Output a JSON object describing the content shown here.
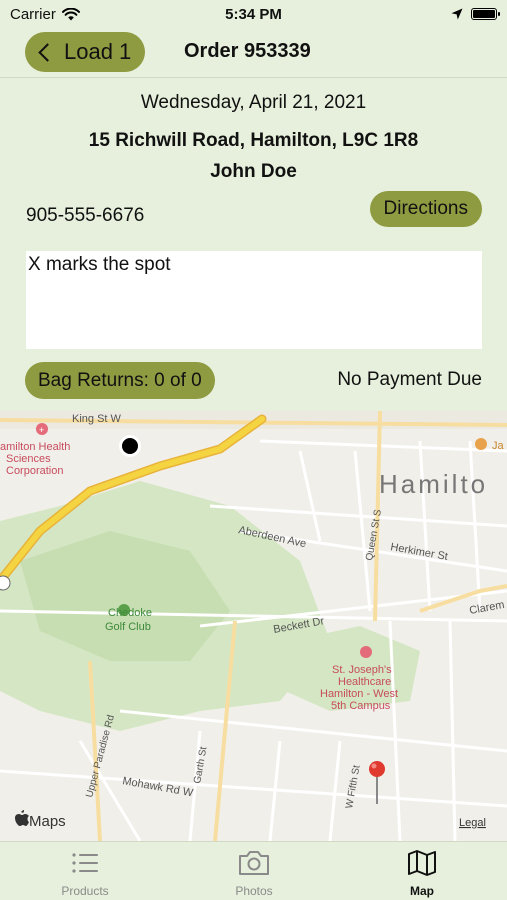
{
  "status_bar": {
    "carrier": "Carrier",
    "time": "5:34 PM"
  },
  "nav": {
    "back_label": "Load 1",
    "title": "Order 953339"
  },
  "order": {
    "date": "Wednesday, April 21, 2021",
    "address": "15 Richwill Road, Hamilton, L9C 1R8",
    "customer": "John Doe",
    "phone": "905-555-6676",
    "directions_label": "Directions",
    "notes": "X marks the spot",
    "bag_returns_label": "Bag Returns: 0 of 0",
    "payment_status": "No Payment Due"
  },
  "map": {
    "labels": {
      "king_st": "King St W",
      "hamilton_health_1": "amilton Health",
      "hamilton_health_2": "Sciences",
      "hamilton_health_3": "Corporation",
      "city": "Hamilto",
      "aberdeen": "Aberdeen Ave",
      "queen": "Queen St S",
      "herkimer": "Herkimer St",
      "chedoke_1": "Chedoke",
      "chedoke_2": "Golf Club",
      "beckett": "Beckett Dr",
      "claremont": "Clarem",
      "st_josephs_1": "St. Joseph's",
      "st_josephs_2": "Healthcare",
      "st_josephs_3": "Hamilton - West",
      "st_josephs_4": "5th Campus",
      "upper_paradise": "Upper Paradise Rd",
      "garth": "Garth St",
      "mohawk": "Mohawk Rd W",
      "west_fifth": "W Fifth St",
      "ja": "Ja",
      "maps_logo": "Maps",
      "legal": "Legal"
    },
    "colors": {
      "highway": "#f5d442",
      "park": "#cfe3bd",
      "pin": "#e03a2f",
      "poi": "#e46b7a"
    }
  },
  "tabs": [
    {
      "label": "Products",
      "icon": "list-icon",
      "active": false
    },
    {
      "label": "Photos",
      "icon": "camera-icon",
      "active": false
    },
    {
      "label": "Map",
      "icon": "map-icon",
      "active": true
    }
  ]
}
